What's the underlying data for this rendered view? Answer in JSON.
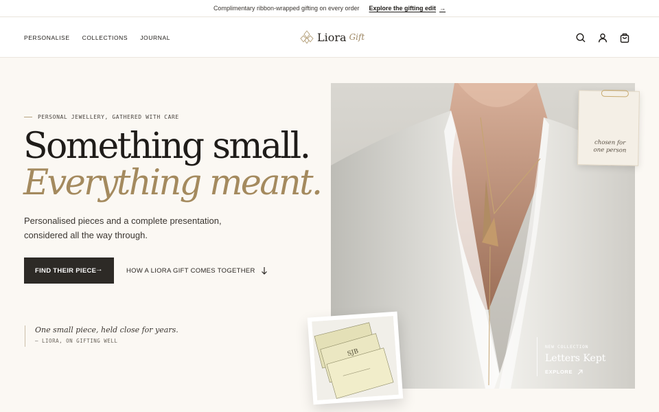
{
  "announcement": {
    "text": "Complimentary ribbon-wrapped gifting on every order",
    "link_label": "Explore the gifting edit",
    "link_arrow": "→"
  },
  "nav": {
    "items": [
      {
        "label": "PERSONALISE"
      },
      {
        "label": "COLLECTIONS"
      },
      {
        "label": "JOURNAL"
      }
    ]
  },
  "brand": {
    "name": "Liora",
    "suffix": "Gift",
    "accent_color": "#a48a5e"
  },
  "header_icons": [
    "search-icon",
    "account-icon",
    "bag-icon"
  ],
  "hero": {
    "eyebrow": "PERSONAL JEWELLERY, GATHERED WITH CARE",
    "headline_line1": "Something small.",
    "headline_line2": "Everything meant.",
    "subcopy": "Personalised pieces and a complete presentation, considered all the way through.",
    "primary_cta": "FIND THEIR PIECE",
    "primary_cta_arrow": "→",
    "secondary_cta": "HOW A LIORA GIFT COMES TOGETHER",
    "secondary_cta_icon": "arrow-down-icon"
  },
  "quote": {
    "text": "One small piece, held close for years.",
    "attribution": "— LIORA, ON GIFTING WELL"
  },
  "tag_card": {
    "text": "chosen for\none person"
  },
  "collection_card": {
    "eyebrow": "NEW COLLECTION",
    "title": "Letters Kept",
    "link_label": "EXPLORE",
    "link_icon": "arrow-up-right-icon"
  },
  "envelope_card": {
    "monogram": "SJB"
  }
}
